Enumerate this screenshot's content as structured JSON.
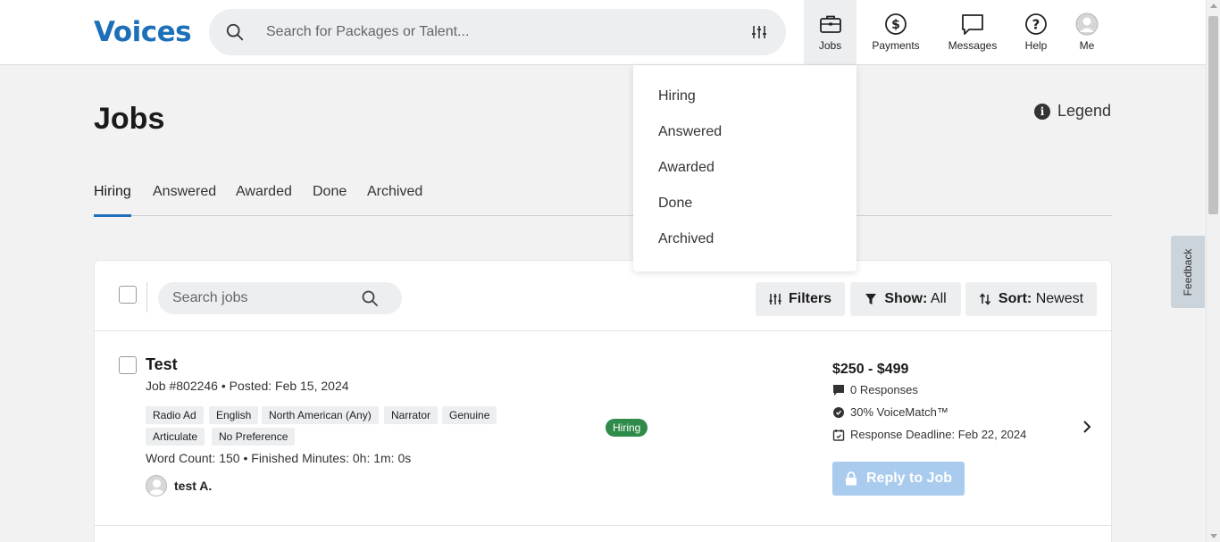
{
  "header": {
    "logo": "Voices",
    "search_placeholder": "Search for Packages or Talent...",
    "nav": {
      "jobs": "Jobs",
      "payments": "Payments",
      "messages": "Messages",
      "help": "Help",
      "me": "Me"
    }
  },
  "page": {
    "title": "Jobs",
    "legend": "Legend"
  },
  "tabs": [
    "Hiring",
    "Answered",
    "Awarded",
    "Done",
    "Archived"
  ],
  "dropdown": [
    "Hiring",
    "Answered",
    "Awarded",
    "Done",
    "Archived"
  ],
  "toolbar": {
    "search_placeholder": "Search jobs",
    "filters": "Filters",
    "show_label": "Show:",
    "show_value": "All",
    "sort_label": "Sort:",
    "sort_value": "Newest"
  },
  "job": {
    "title": "Test",
    "meta": "Job #802246 • Posted: Feb 15, 2024",
    "tags": [
      "Radio Ad",
      "English",
      "North American (Any)",
      "Narrator",
      "Genuine",
      "Articulate",
      "No Preference"
    ],
    "word_count": "Word Count: 150 • Finished Minutes: 0h: 1m: 0s",
    "author": "test A.",
    "status": "Hiring",
    "budget": "$250 - $499",
    "responses": "0 Responses",
    "voicematch": "30% VoiceMatch™",
    "deadline": "Response Deadline: Feb 22, 2024",
    "reply_label": "Reply to Job"
  },
  "feedback": "Feedback",
  "colors": {
    "brand": "#1c6fb8",
    "hiring_badge": "#2e8b4a",
    "reply_disabled": "#a9cbee"
  }
}
